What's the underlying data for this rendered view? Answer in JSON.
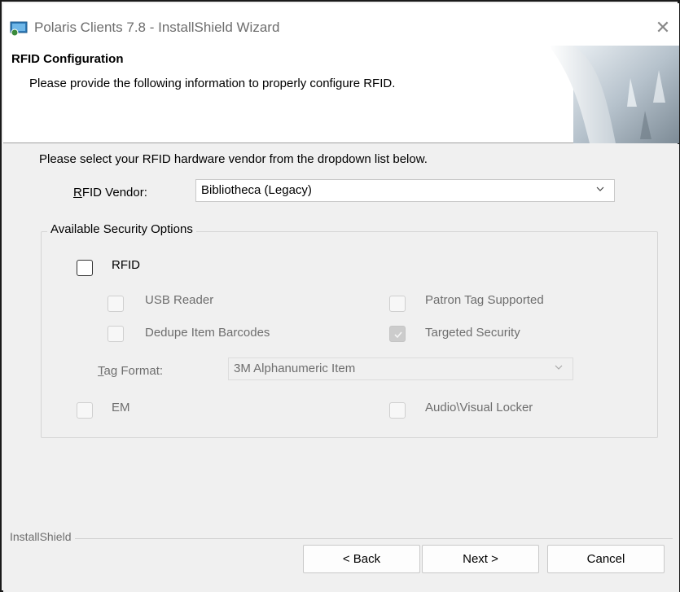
{
  "window": {
    "title": "Polaris Clients 7.8 - InstallShield Wizard",
    "close_glyph": "✕"
  },
  "header": {
    "title": "RFID Configuration",
    "subtitle": "Please provide the following information to properly configure RFID."
  },
  "main": {
    "instruction": "Please select your RFID hardware vendor from the dropdown list below.",
    "vendor_label_accel": "R",
    "vendor_label_rest": "FID Vendor:",
    "vendor_value": "Bibliotheca (Legacy)",
    "security_group_title": "Available Security Options",
    "options": {
      "rfid": {
        "label": "RFID",
        "checked": false,
        "enabled": true
      },
      "usb_reader": {
        "label": "USB Reader",
        "checked": false,
        "enabled": false
      },
      "patron_tag": {
        "label": "Patron Tag Supported",
        "checked": false,
        "enabled": false
      },
      "dedupe": {
        "label": "Dedupe Item Barcodes",
        "checked": false,
        "enabled": false
      },
      "targeted_security": {
        "label": "Targeted Security",
        "checked": true,
        "enabled": false
      },
      "em": {
        "label": "EM",
        "checked": false,
        "enabled": false
      },
      "av_locker": {
        "label": "Audio\\Visual Locker",
        "checked": false,
        "enabled": false
      }
    },
    "tag_format_label_accel": "T",
    "tag_format_label_rest": "ag Format:",
    "tag_format_value": "3M Alphanumeric Item"
  },
  "footer": {
    "brand": "InstallShield",
    "back_label": "< Back",
    "next_label": "Next >",
    "cancel_label": "Cancel"
  },
  "colors": {
    "dialog_bg": "#f0f0f0",
    "header_bg": "#ffffff",
    "disabled_text": "#6e6e6e"
  },
  "icons": {
    "app": "installer-icon",
    "close": "close-icon",
    "dropdown": "chevron-down-icon",
    "check": "checkmark-icon"
  }
}
